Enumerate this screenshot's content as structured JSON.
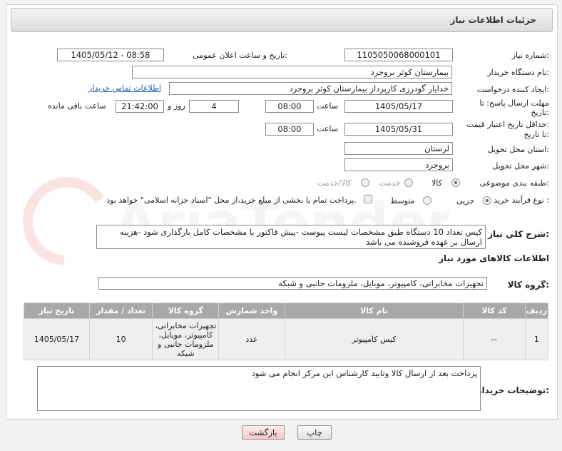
{
  "page": {
    "title": "جزئیات اطلاعات نیاز"
  },
  "form": {
    "need_number_label": "شماره نیاز:",
    "need_number": "1105050068000101",
    "announce_label": "تاریخ و ساعت اعلان عمومی:",
    "announce_value": "1405/05/12 - 08:58",
    "buyer_org_label": "نام دستگاه خریدار:",
    "buyer_org": "بیمارستان کوثر بروجرد",
    "creator_label": "ایجاد کننده درخواست:",
    "creator": "خدایار  گودرزی کارپرداز بیمارستان کوثر بروجرد",
    "buyer_contact_link": "اطلاعات تماس خریدار",
    "reply_deadline_label_1": "مهلت ارسال پاسخ: تا",
    "reply_deadline_label_2": "تاریخ:",
    "reply_date": "1405/05/17",
    "time_label": "ساعت",
    "reply_time": "08:00",
    "days_value": "4",
    "days_label": "روز و",
    "remaining_time": "21:42:00",
    "remaining_label": "ساعت باقی مانده",
    "price_validity_label_1": "حداقل تاریخ اعتبار قیمت:",
    "price_validity_label_2": "تا تاریخ:",
    "price_date": "1405/05/31",
    "price_time": "08:00",
    "province_label": "استان محل تحویل:",
    "province": "لرستان",
    "city_label": "شهر محل تحویل:",
    "city": "بروجرد",
    "category_label": "طبقه بندی موضوعی:",
    "category_options": [
      "کالا",
      "خدمت",
      "کالا/خدمت"
    ],
    "purchase_type_label": "نوع فرآیند خرید :",
    "purchase_options": [
      "جزیی",
      "متوسط"
    ],
    "payment_note": "پرداخت تمام یا بخشی از مبلغ خرید،از محل \"اسناد خزانه اسلامی\" خواهد بود.",
    "description_label": "شرح کلي نياز:",
    "description": "کیس تعداد 10 دستگاه طبق مشخصات لیست پیوست -پیش فاکتور با مشخصات کامل بارگذاری شود -هزینه ارسال بر عهده فروشنده می باشد",
    "goods_info_title": "اطلاعات کالاهای مورد نیاز",
    "goods_group_label": "گروه کالا:",
    "goods_group": "تجهیزات مخابراتی، کامپیوتر، موبایل، ملزومات جانبی و شبکه"
  },
  "table": {
    "headers": [
      "ردیف",
      "کد کالا",
      "نام کالا",
      "واحد شمارش",
      "گروه کالا",
      "تعداد / مقدار",
      "تاریخ نیاز"
    ],
    "rows": [
      [
        "1",
        "--",
        "کیس کامپیوتر",
        "عدد",
        "تجهیزات مخابراتی، کامپیوتر، موبایل، ملزومات جانبی و شبکه",
        "10",
        "1405/05/17"
      ]
    ]
  },
  "buyer_notes": {
    "label": "توضیحات خریدار:",
    "text": "پرداخت بعد از ارسال کالا وتایید کارشناس این مرکز  انجام می شود"
  },
  "buttons": {
    "print": "چاپ",
    "back": "بازگشت"
  },
  "watermark": {
    "text": "AriaTender.net"
  },
  "colors": {
    "table_header": "#a8a8a8",
    "link": "#1a5fb4"
  }
}
